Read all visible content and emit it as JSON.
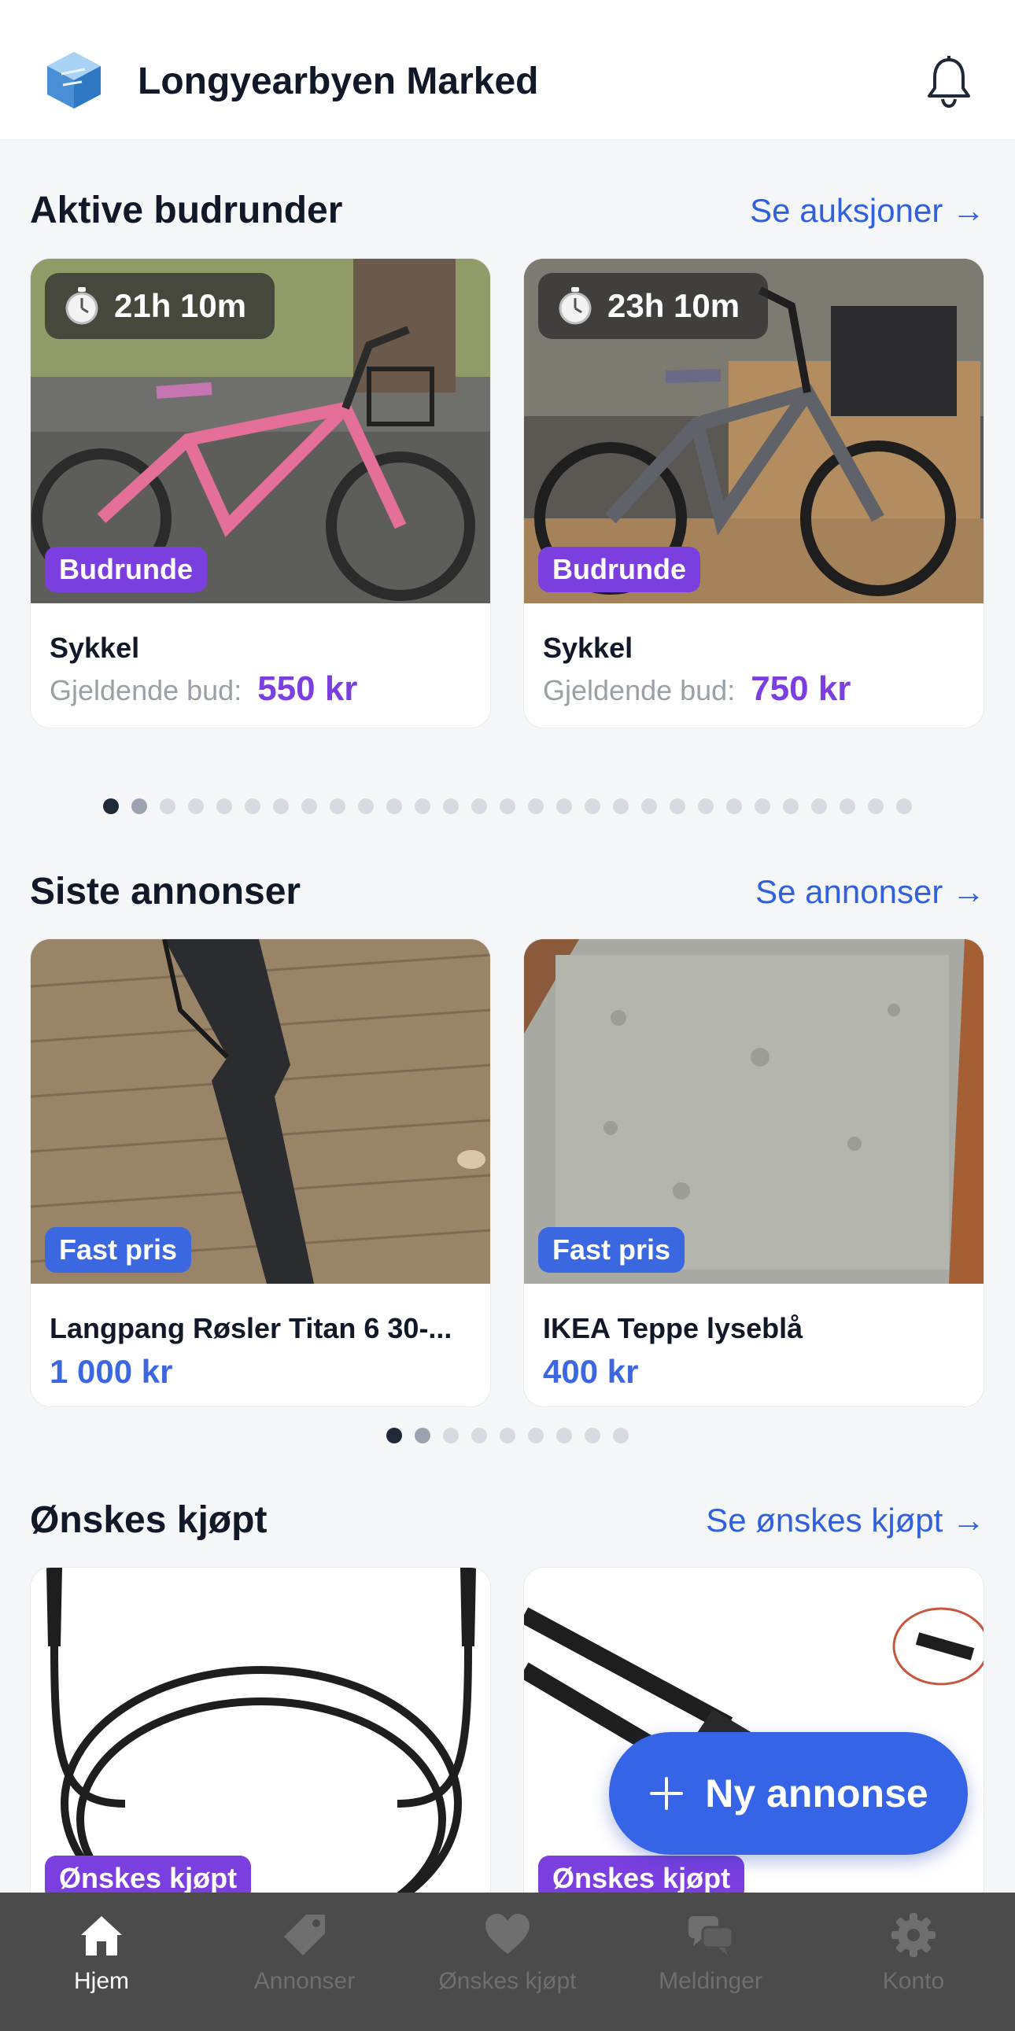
{
  "header": {
    "title": "Longyearbyen Marked",
    "logo_icon": "cube-logo-icon",
    "bell_icon": "bell-icon"
  },
  "auctions": {
    "title": "Aktive budrunder",
    "link": "Se auksjoner →",
    "items": [
      {
        "timer": "21h 10m",
        "badge": "Budrunde",
        "title": "Sykkel",
        "bid_label": "Gjeldende bud:",
        "bid_value": "550 kr"
      },
      {
        "timer": "23h 10m",
        "badge": "Budrunde",
        "title": "Sykkel",
        "bid_label": "Gjeldende bud:",
        "bid_value": "750 kr"
      }
    ],
    "pager": {
      "count": 29,
      "active": 0
    }
  },
  "listings": {
    "title": "Siste annonser",
    "link": "Se annonser →",
    "items": [
      {
        "badge": "Fast pris",
        "title": "Langpang Røsler Titan 6 30-...",
        "price": "1 000 kr"
      },
      {
        "badge": "Fast pris",
        "title": "IKEA Teppe lyseblå",
        "price": "400 kr"
      }
    ],
    "pager": {
      "count": 9,
      "active": 0
    }
  },
  "wanted": {
    "title": "Ønskes kjøpt",
    "link": "Se ønskes kjøpt →",
    "items": [
      {
        "badge": "Ønskes kjøpt"
      },
      {
        "badge": "Ønskes kjøpt"
      }
    ]
  },
  "fab": {
    "label": "Ny annonse",
    "icon": "plus-icon"
  },
  "tabbar": {
    "tabs": [
      {
        "label": "Hjem",
        "icon": "home-icon",
        "active": true
      },
      {
        "label": "Annonser",
        "icon": "tag-icon",
        "active": false
      },
      {
        "label": "Ønskes kjøpt",
        "icon": "heart-icon",
        "active": false
      },
      {
        "label": "Meldinger",
        "icon": "chat-bubbles-icon",
        "active": false
      },
      {
        "label": "Konto",
        "icon": "gear-icon",
        "active": false
      }
    ]
  },
  "colors": {
    "accent_blue": "#3160dc",
    "auction_purple": "#7b3fe0",
    "tabbar_bg": "#4b4b4b"
  }
}
